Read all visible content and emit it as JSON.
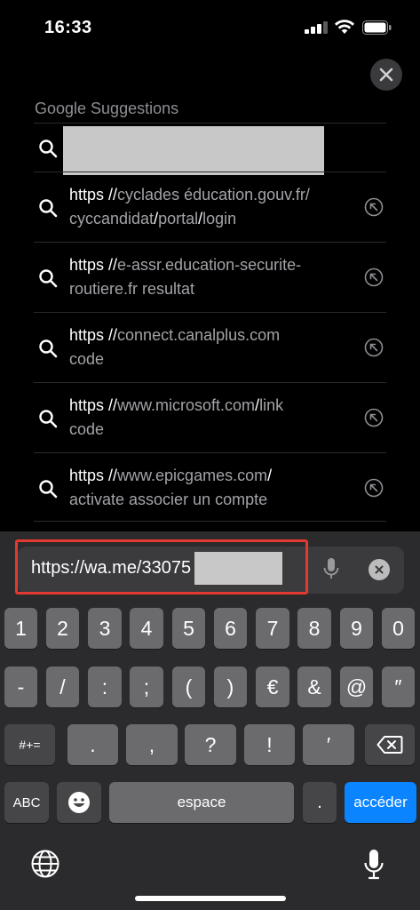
{
  "status": {
    "time": "16:33"
  },
  "suggestions_section": {
    "title": "Google Suggestions"
  },
  "suggestions": [
    {
      "prefix": "https //",
      "rest1": "cyclades éducation.gouv.fr/",
      "line2_a": "cyccandidat",
      "sep1": "/",
      "line2_b": "portal",
      "sep2": "/",
      "line2_c": "login"
    },
    {
      "prefix": "https //",
      "rest1": "e-assr.education-securite-",
      "line2": "routiere.fr resultat"
    },
    {
      "prefix": "https //",
      "rest1": "connect.canalplus.com",
      "line2": "code"
    },
    {
      "prefix": "https //",
      "rest1": "www.microsoft.com",
      "sep": "/",
      "rest1b": "link",
      "line2": "code"
    },
    {
      "prefix": "https //",
      "rest1": "www.epicgames.com",
      "sep": "/",
      "line2": "activate associer un compte"
    }
  ],
  "address_bar": {
    "value": "https://wa.me/33075"
  },
  "keyboard": {
    "row1": [
      "1",
      "2",
      "3",
      "4",
      "5",
      "6",
      "7",
      "8",
      "9",
      "0"
    ],
    "row2": [
      "-",
      "/",
      ":",
      ";",
      "(",
      ")",
      "€",
      "&",
      "@",
      "″"
    ],
    "row3_mod": "#+=",
    "row3": [
      ".",
      ",",
      "?",
      "!",
      "′"
    ],
    "row4": {
      "abc": "ABC",
      "space": "espace",
      "dot": ".",
      "go": "accéder"
    }
  },
  "colors": {
    "accent": "#0a84ff",
    "highlight": "#e23a30",
    "background": "#000000",
    "keyboard": "#2b2b2d"
  },
  "icons": [
    "search-icon",
    "close-icon",
    "arrow-up-left-icon",
    "mic-icon",
    "clear-icon",
    "globe-icon",
    "emoji-icon",
    "backspace-icon",
    "signal-icon",
    "wifi-icon",
    "battery-icon"
  ]
}
